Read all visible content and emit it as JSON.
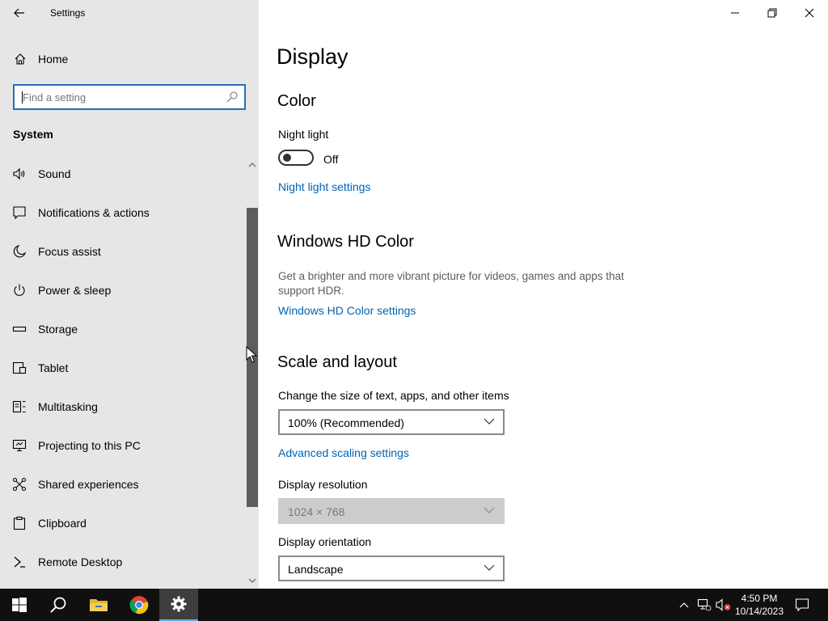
{
  "window": {
    "title": "Settings"
  },
  "sidebar": {
    "home_label": "Home",
    "search": {
      "placeholder": "Find a setting",
      "value": ""
    },
    "section_label": "System",
    "items": [
      {
        "label": "Sound",
        "icon": "speaker-icon"
      },
      {
        "label": "Notifications & actions",
        "icon": "notification-icon"
      },
      {
        "label": "Focus assist",
        "icon": "moon-icon"
      },
      {
        "label": "Power & sleep",
        "icon": "power-icon"
      },
      {
        "label": "Storage",
        "icon": "storage-icon"
      },
      {
        "label": "Tablet",
        "icon": "tablet-icon"
      },
      {
        "label": "Multitasking",
        "icon": "multitasking-icon"
      },
      {
        "label": "Projecting to this PC",
        "icon": "projecting-icon"
      },
      {
        "label": "Shared experiences",
        "icon": "shared-icon"
      },
      {
        "label": "Clipboard",
        "icon": "clipboard-icon"
      },
      {
        "label": "Remote Desktop",
        "icon": "remote-desktop-icon"
      }
    ]
  },
  "main": {
    "page_title": "Display",
    "color": {
      "heading": "Color",
      "night_light_label": "Night light",
      "night_light_state": "Off",
      "night_light_link": "Night light settings"
    },
    "hd_color": {
      "heading": "Windows HD Color",
      "description": "Get a brighter and more vibrant picture for videos, games and apps that support HDR.",
      "link": "Windows HD Color settings"
    },
    "scale_layout": {
      "heading": "Scale and layout",
      "scale_label": "Change the size of text, apps, and other items",
      "scale_value": "100% (Recommended)",
      "advanced_link": "Advanced scaling settings",
      "resolution_label": "Display resolution",
      "resolution_value": "1024 × 768",
      "orientation_label": "Display orientation",
      "orientation_value": "Landscape"
    }
  },
  "taskbar": {
    "time": "4:50 PM",
    "date": "10/14/2023"
  },
  "colors": {
    "accent": "#0063b1",
    "sidebar_bg": "#e6e6e6",
    "taskbar_bg": "#101010",
    "search_border": "#2a6fb8"
  }
}
